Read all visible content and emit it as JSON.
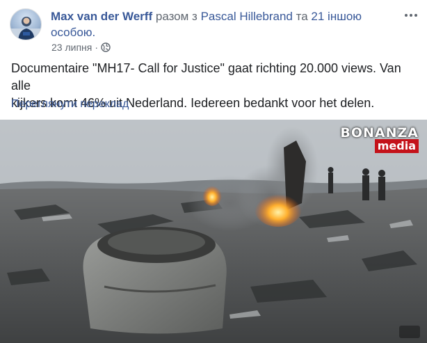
{
  "post": {
    "author": "Max van der Werff",
    "with_word": "разом з",
    "tagged_person": "Pascal Hillebrand",
    "and_word": "та",
    "others": "21 іншою особою.",
    "date": "23 липня",
    "privacy_icon": "globe-icon",
    "text_line1": "Documentaire \"MH17- Call for Justice\" gaat richting 20.000 views. Van alle",
    "text_line2": "kijkers komt 46% uit Nederland. Iedereen bedankt voor het delen.",
    "see_translation": "Переглянути переклад",
    "more_icon": "more-options-icon"
  },
  "media": {
    "watermark_top": "BONANZA",
    "watermark_bottom": "media"
  },
  "colors": {
    "link": "#385898",
    "text": "#1c1e21",
    "meta": "#606770",
    "watermark_red": "#c4121a"
  }
}
